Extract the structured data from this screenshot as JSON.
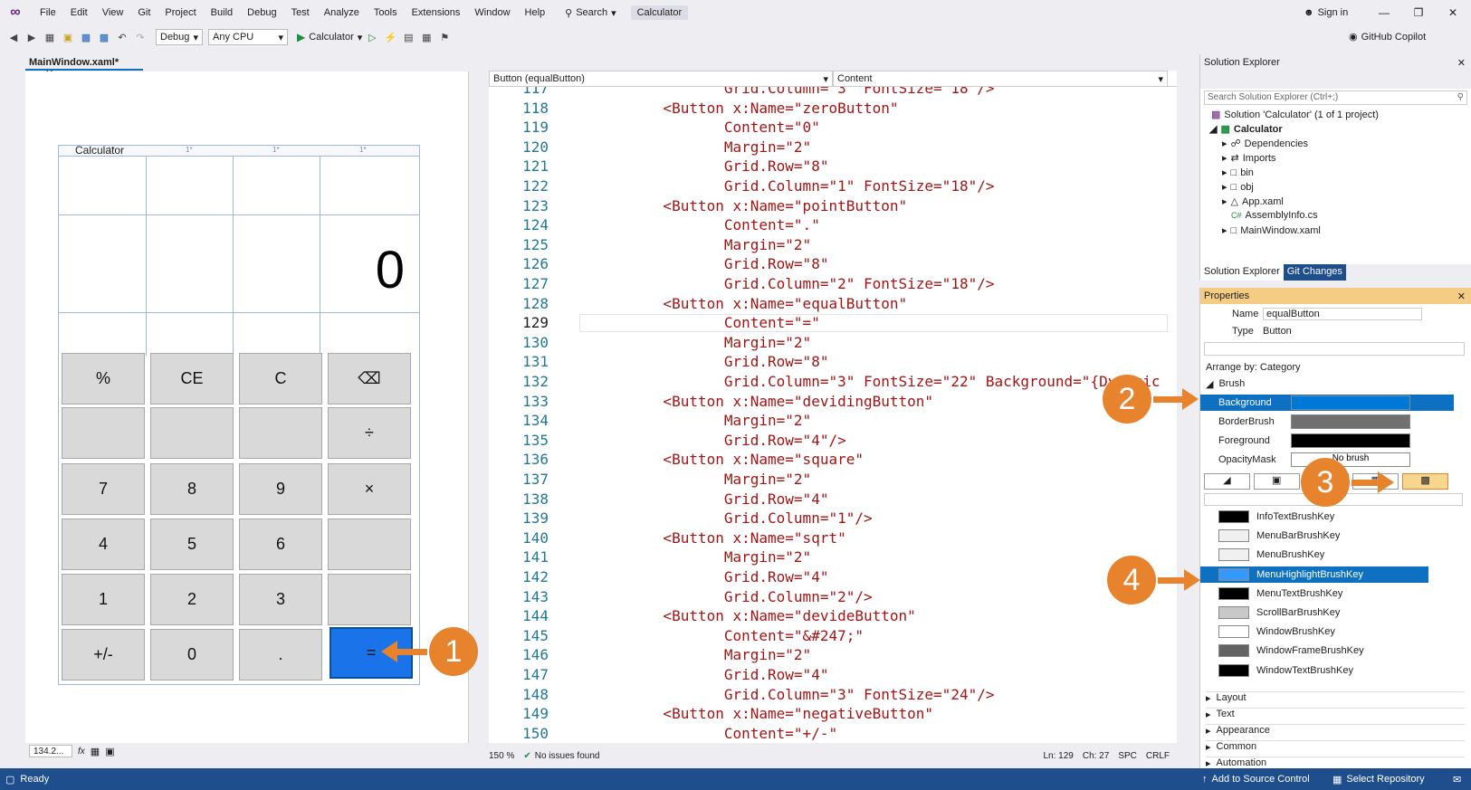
{
  "menu": {
    "items": [
      "File",
      "Edit",
      "View",
      "Git",
      "Project",
      "Build",
      "Debug",
      "Test",
      "Analyze",
      "Tools",
      "Extensions",
      "Window",
      "Help"
    ],
    "search_label": "Search",
    "solution_title": "Calculator",
    "sign_in": "Sign in"
  },
  "toolbar": {
    "config": "Debug",
    "platform": "Any CPU",
    "run_target": "Calculator",
    "copilot": "GitHub Copilot"
  },
  "designer": {
    "tab_label": "MainWindow.xaml*",
    "window_title": "Calculator",
    "display_value": "0",
    "col_ticks": [
      "1*",
      "1*",
      "1*",
      "1*"
    ],
    "buttons": [
      "%",
      "CE",
      "C",
      "⌫",
      "",
      "",
      "",
      "÷",
      "7",
      "8",
      "9",
      "×",
      "4",
      "5",
      "6",
      "",
      "1",
      "2",
      "3",
      "",
      "+/-",
      "0",
      ".",
      "="
    ],
    "zoom": "134.2...",
    "fx": "fx"
  },
  "markers": [
    "1",
    "2",
    "3",
    "4"
  ],
  "editor": {
    "nav_left": "Button (equalButton)",
    "nav_right": "Content",
    "lines": [
      {
        "n": "117",
        "t": "              Grid.Column=\"3\" FontSize=\"18\"/>"
      },
      {
        "n": "118",
        "t": "       <Button x:Name=\"zeroButton\""
      },
      {
        "n": "119",
        "t": "              Content=\"0\""
      },
      {
        "n": "120",
        "t": "              Margin=\"2\""
      },
      {
        "n": "121",
        "t": "              Grid.Row=\"8\""
      },
      {
        "n": "122",
        "t": "              Grid.Column=\"1\" FontSize=\"18\"/>"
      },
      {
        "n": "123",
        "t": "       <Button x:Name=\"pointButton\""
      },
      {
        "n": "124",
        "t": "              Content=\".\""
      },
      {
        "n": "125",
        "t": "              Margin=\"2\""
      },
      {
        "n": "126",
        "t": "              Grid.Row=\"8\""
      },
      {
        "n": "127",
        "t": "              Grid.Column=\"2\" FontSize=\"18\"/>"
      },
      {
        "n": "128",
        "t": "       <Button x:Name=\"equalButton\""
      },
      {
        "n": "129",
        "t": "              Content=\"=\""
      },
      {
        "n": "130",
        "t": "              Margin=\"2\""
      },
      {
        "n": "131",
        "t": "              Grid.Row=\"8\""
      },
      {
        "n": "132",
        "t": "              Grid.Column=\"3\" FontSize=\"22\" Background=\"{Dynamic"
      },
      {
        "n": "133",
        "t": "       <Button x:Name=\"devidingButton\""
      },
      {
        "n": "134",
        "t": "              Margin=\"2\""
      },
      {
        "n": "135",
        "t": "              Grid.Row=\"4\"/>"
      },
      {
        "n": "136",
        "t": "       <Button x:Name=\"square\""
      },
      {
        "n": "137",
        "t": "              Margin=\"2\""
      },
      {
        "n": "138",
        "t": "              Grid.Row=\"4\""
      },
      {
        "n": "139",
        "t": "              Grid.Column=\"1\"/>"
      },
      {
        "n": "140",
        "t": "       <Button x:Name=\"sqrt\""
      },
      {
        "n": "141",
        "t": "              Margin=\"2\""
      },
      {
        "n": "142",
        "t": "              Grid.Row=\"4\""
      },
      {
        "n": "143",
        "t": "              Grid.Column=\"2\"/>"
      },
      {
        "n": "144",
        "t": "       <Button x:Name=\"devideButton\""
      },
      {
        "n": "145",
        "t": "              Content=\"&#247;\""
      },
      {
        "n": "146",
        "t": "              Margin=\"2\""
      },
      {
        "n": "147",
        "t": "              Grid.Row=\"4\""
      },
      {
        "n": "148",
        "t": "              Grid.Column=\"3\" FontSize=\"24\"/>"
      },
      {
        "n": "149",
        "t": "       <Button x:Name=\"negativeButton\""
      },
      {
        "n": "150",
        "t": "              Content=\"+/-\""
      },
      {
        "n": "151",
        "t": "              Margin=\"2\""
      }
    ],
    "zoom": "150 %",
    "issues": "No issues found",
    "ln": "Ln: 129",
    "ch": "Ch: 27",
    "spc": "SPC",
    "crlf": "CRLF"
  },
  "solution_explorer": {
    "title": "Solution Explorer",
    "search_placeholder": "Search Solution Explorer (Ctrl+;)",
    "solution": "Solution 'Calculator' (1 of 1 project)",
    "project": "Calculator",
    "items": [
      "Dependencies",
      "Imports",
      "bin",
      "obj",
      "App.xaml",
      "AssemblyInfo.cs",
      "MainWindow.xaml"
    ],
    "tab_active": "Solution Explorer",
    "tab_other": "Git Changes"
  },
  "properties": {
    "title": "Properties",
    "name_label": "Name",
    "name_value": "equalButton",
    "type_label": "Type",
    "type_value": "Button",
    "arrange": "Arrange by: Category",
    "brush_cat": "Brush",
    "brush_props": [
      {
        "label": "Background",
        "color": "#0078d7"
      },
      {
        "label": "BorderBrush",
        "color": "#707070"
      },
      {
        "label": "Foreground",
        "color": "#000000"
      },
      {
        "label": "OpacityMask",
        "color": "#ffffff",
        "text": "No brush"
      }
    ],
    "brush_keys": [
      {
        "label": "InfoTextBrushKey",
        "color": "#000000"
      },
      {
        "label": "MenuBarBrushKey",
        "color": "#f0f0f0"
      },
      {
        "label": "MenuBrushKey",
        "color": "#f0f0f0"
      },
      {
        "label": "MenuHighlightBrushKey",
        "color": "#3399ff"
      },
      {
        "label": "MenuTextBrushKey",
        "color": "#000000"
      },
      {
        "label": "ScrollBarBrushKey",
        "color": "#c8c8c8"
      },
      {
        "label": "WindowBrushKey",
        "color": "#ffffff"
      },
      {
        "label": "WindowFrameBrushKey",
        "color": "#646464"
      },
      {
        "label": "WindowTextBrushKey",
        "color": "#000000"
      }
    ],
    "categories": [
      "Layout",
      "Text",
      "Appearance",
      "Common",
      "Automation"
    ]
  },
  "statusbar": {
    "ready": "Ready",
    "source_control": "Add to Source Control",
    "repository": "Select Repository"
  },
  "colors": {
    "accent": "#0078d7",
    "marker": "#e8832d",
    "statusbar": "#1f4e8c"
  }
}
